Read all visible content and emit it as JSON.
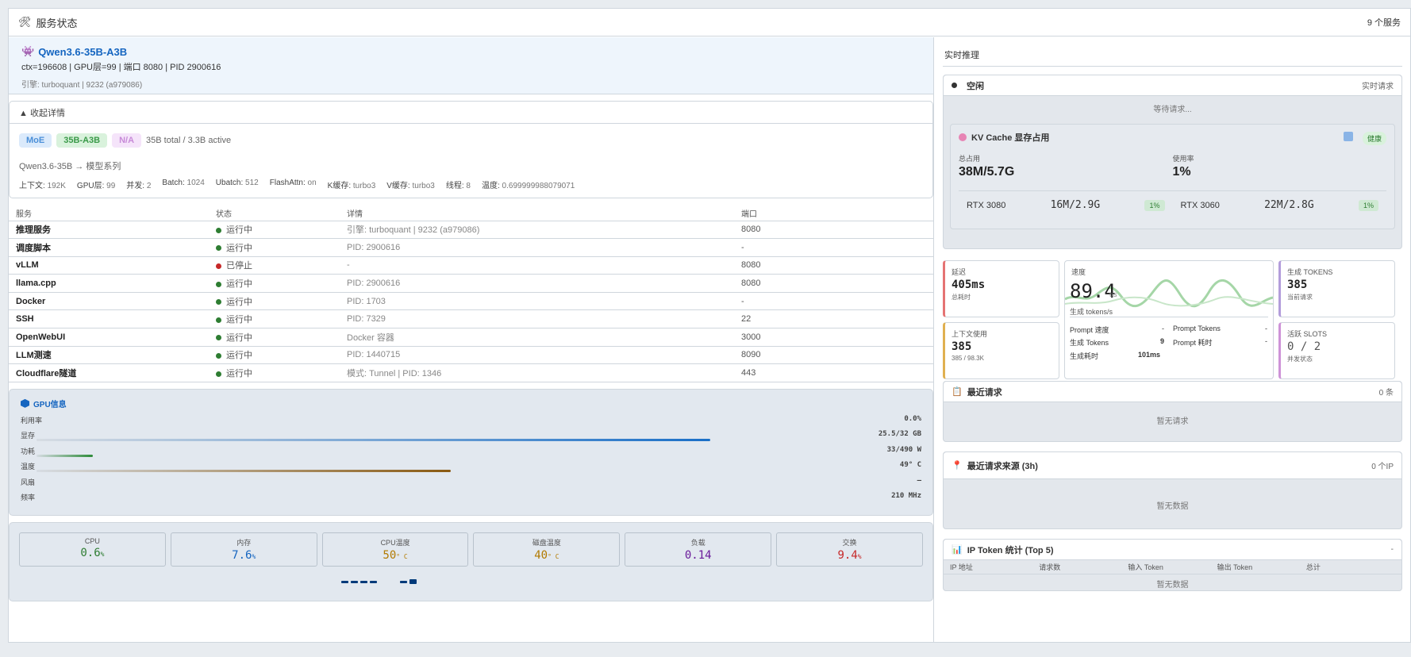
{
  "header": {
    "title": "服务状态",
    "count": "9 个服务"
  },
  "model": {
    "name": "Qwen3.6-35B-A3B",
    "info": "ctx=196608 | GPU层=99 | 端口 8080 | PID 2900616",
    "engine": "引擎: turboquant | 9232 (a979086)"
  },
  "details": {
    "toggle": "▲ 收起详情",
    "tags": [
      "MoE",
      "35B-A3B",
      "N/A"
    ],
    "params_total": "35B total / 3.3B active",
    "series": "Qwen3.6-35B → 模型系列",
    "params": [
      {
        "k": "上下文:",
        "v": "192K"
      },
      {
        "k": "GPU层:",
        "v": "99"
      },
      {
        "k": "并发:",
        "v": "2"
      },
      {
        "k": "Batch:",
        "v": "1024"
      },
      {
        "k": "Ubatch:",
        "v": "512"
      },
      {
        "k": "FlashAttn:",
        "v": "on"
      },
      {
        "k": "K缓存:",
        "v": "turbo3"
      },
      {
        "k": "V缓存:",
        "v": "turbo3"
      },
      {
        "k": "线程:",
        "v": "8"
      },
      {
        "k": "温度:",
        "v": "0.699999988079071"
      }
    ]
  },
  "services": {
    "headers": [
      "服务",
      "状态",
      "详情",
      "端口"
    ],
    "rows": [
      {
        "name": "推理服务",
        "status": "运行中",
        "ok": true,
        "detail": "引擎: turboquant | 9232 (a979086)",
        "port": "8080"
      },
      {
        "name": "调度脚本",
        "status": "运行中",
        "ok": true,
        "detail": "PID: 2900616",
        "port": "-"
      },
      {
        "name": "vLLM",
        "status": "已停止",
        "ok": false,
        "detail": "-",
        "port": "8080"
      },
      {
        "name": "llama.cpp",
        "status": "运行中",
        "ok": true,
        "detail": "PID: 2900616",
        "port": "8080"
      },
      {
        "name": "Docker",
        "status": "运行中",
        "ok": true,
        "detail": "PID: 1703",
        "port": "-"
      },
      {
        "name": "SSH",
        "status": "运行中",
        "ok": true,
        "detail": "PID: 7329",
        "port": "22"
      },
      {
        "name": "OpenWebUI",
        "status": "运行中",
        "ok": true,
        "detail": "Docker 容器",
        "port": "3000"
      },
      {
        "name": "LLM测速",
        "status": "运行中",
        "ok": true,
        "detail": "PID: 1440715",
        "port": "8090"
      },
      {
        "name": "Cloudflare隧道",
        "status": "运行中",
        "ok": true,
        "detail": "模式: Tunnel | PID: 1346",
        "port": "443"
      }
    ]
  },
  "gpu": {
    "title": "GPU信息",
    "rows": [
      {
        "label": "利用率",
        "value": "0.0%",
        "fill": 0,
        "color": ""
      },
      {
        "label": "显存",
        "value": "25.5/32 GB",
        "fill": 0.797,
        "color": "#1a6fc7"
      },
      {
        "label": "功耗",
        "value": "33/490 W",
        "fill": 0.067,
        "color": "#2e8b3a"
      },
      {
        "label": "温度",
        "value": "49° C",
        "fill": 0.49,
        "color": "#8a5a12"
      },
      {
        "label": "风扇",
        "value": "—",
        "fill": 0,
        "color": ""
      },
      {
        "label": "频率",
        "value": "210 MHz",
        "fill": 0,
        "color": ""
      }
    ]
  },
  "system": [
    {
      "label": "CPU",
      "value": "0.6",
      "unit": "%",
      "color": "#2e7d32"
    },
    {
      "label": "内存",
      "value": "7.6",
      "unit": "%",
      "color": "#1565c0"
    },
    {
      "label": "CPU温度",
      "value": "50",
      "unit": "° C",
      "color": "#b27a00"
    },
    {
      "label": "磁盘温度",
      "value": "40",
      "unit": "° C",
      "color": "#b27a00"
    },
    {
      "label": "负载",
      "value": "0.14",
      "unit": "",
      "color": "#6a1b9a"
    },
    {
      "label": "交换",
      "value": "9.4",
      "unit": "%",
      "color": "#c62828"
    }
  ],
  "realtime": {
    "title": "实时推理",
    "state": "空闲",
    "state_right": "实时请求",
    "waiting": "等待请求...",
    "kv": {
      "title": "KV Cache 显存占用",
      "badge": "健康",
      "total_label": "总占用",
      "total_value": "38M/5.7G",
      "usage_label": "使用率",
      "usage_value": "1%",
      "gpus": [
        {
          "name": "RTX 3080",
          "value": "16M/2.9G",
          "pct": "1%"
        },
        {
          "name": "RTX 3060",
          "value": "22M/2.8G",
          "pct": "1%"
        }
      ]
    },
    "latency": {
      "label": "延迟",
      "value": "405ms",
      "sub": "总耗时"
    },
    "speed": {
      "label": "速度",
      "value": "89.4",
      "unit": "t/s",
      "sub": "生成 tokens/s",
      "stats": [
        {
          "k": "Prompt 速度",
          "v": "-"
        },
        {
          "k": "Prompt Tokens",
          "v": "-"
        },
        {
          "k": "生成 Tokens",
          "v": "9"
        },
        {
          "k": "Prompt 耗时",
          "v": "-"
        },
        {
          "k": "生成耗时",
          "v": "101ms"
        }
      ]
    },
    "tokens": {
      "label": "生成 TOKENS",
      "value": "385",
      "sub": "当前请求"
    },
    "ctx": {
      "label": "上下文使用",
      "value": "385",
      "sub": "385 / 98.3K"
    },
    "slots": {
      "label": "活跃 SLOTS",
      "value": "0 / 2",
      "sub": "并发状态"
    }
  },
  "recent": {
    "title": "最近请求",
    "count": "0 条",
    "empty": "暂无请求"
  },
  "sources": {
    "title": "最近请求来源 (3h)",
    "count": "0 个IP",
    "empty": "暂无数据"
  },
  "iptoken": {
    "title": "IP Token 统计 (Top 5)",
    "right": "-",
    "headers": [
      "IP 地址",
      "请求数",
      "输入 Token",
      "输出 Token",
      "总计"
    ],
    "empty": "暂无数据"
  }
}
